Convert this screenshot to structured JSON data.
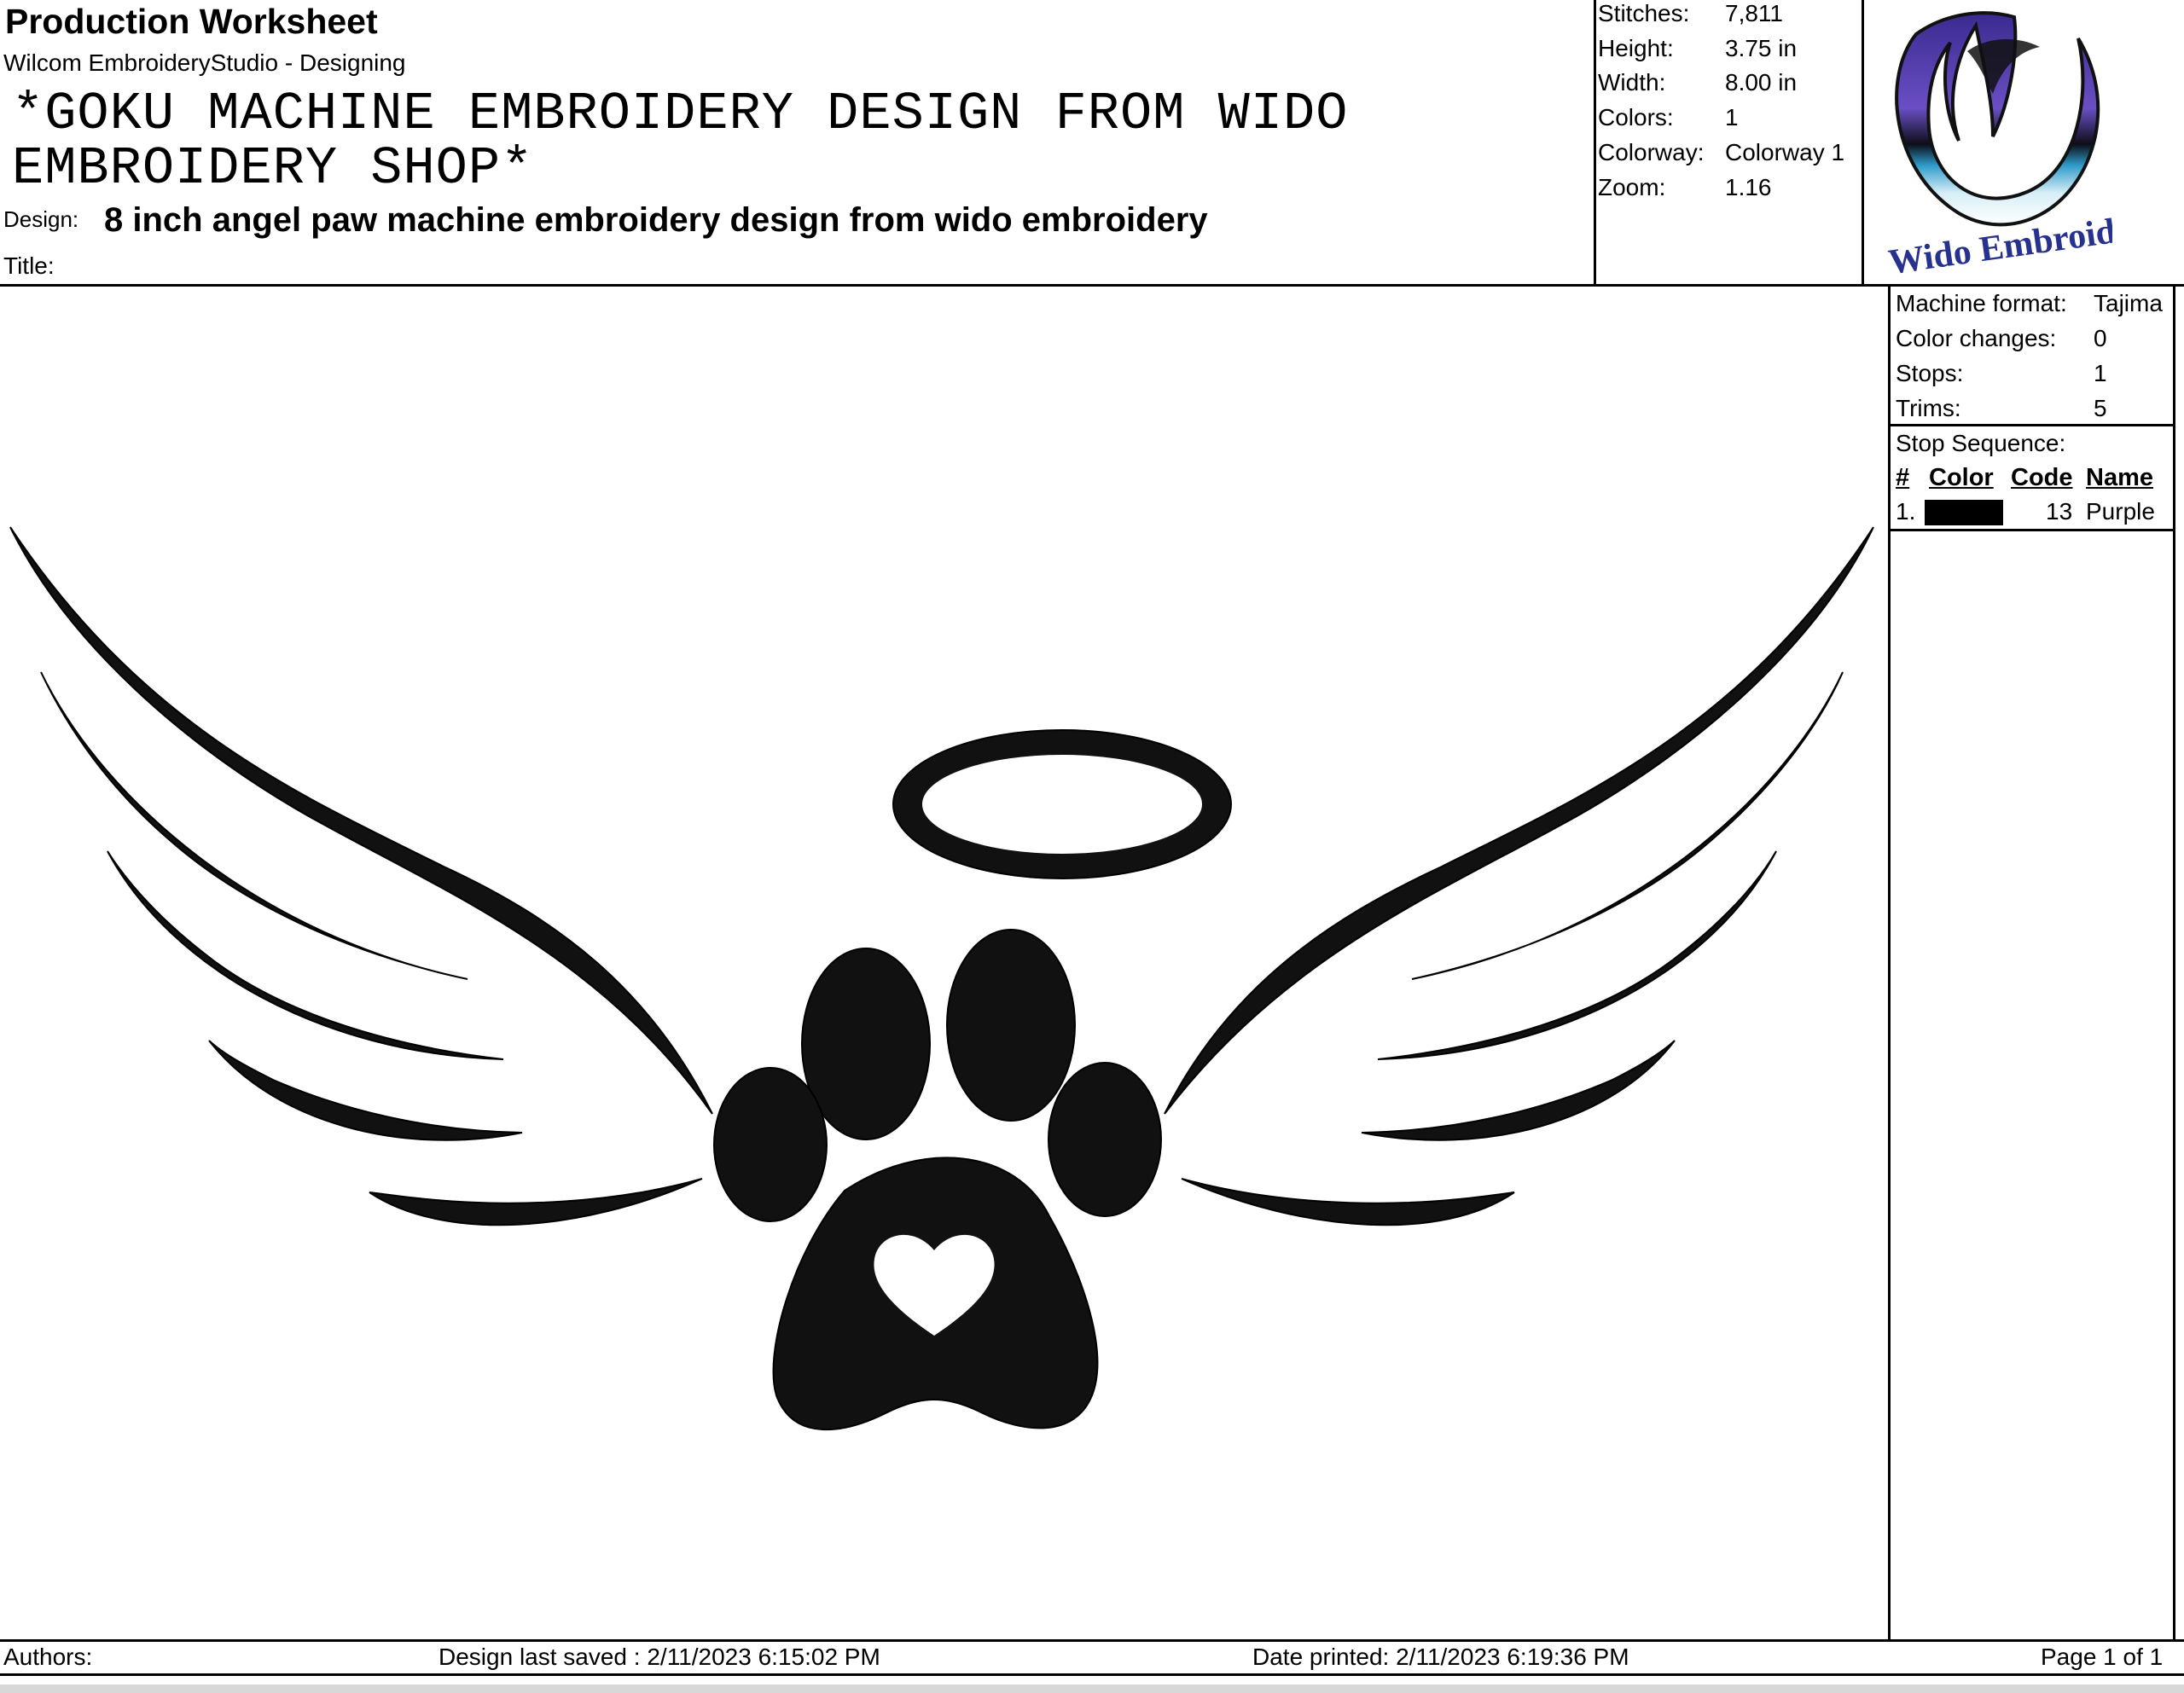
{
  "header": {
    "title": "Production Worksheet",
    "subtitle": "Wilcom EmbroideryStudio - Designing",
    "description": "*GOKU MACHINE EMBROIDERY DESIGN FROM WIDO EMBROIDERY SHOP*",
    "design_label": "Design:",
    "design_value": "8  inch angel paw machine embroidery design from wido embroidery",
    "title_label": "Title:",
    "title_value": ""
  },
  "stats": [
    {
      "label": "Stitches:",
      "value": "7,811"
    },
    {
      "label": "Height:",
      "value": "3.75 in"
    },
    {
      "label": "Width:",
      "value": "8.00 in"
    },
    {
      "label": "Colors:",
      "value": "1"
    },
    {
      "label": "Colorway:",
      "value": "Colorway 1"
    },
    {
      "label": "Zoom:",
      "value": "1.16"
    }
  ],
  "logo": {
    "text": "Wido Embroidery",
    "icon": "wido-logo-icon"
  },
  "machine": [
    {
      "label": "Machine format:",
      "value": "Tajima"
    },
    {
      "label": "Color changes:",
      "value": "0"
    },
    {
      "label": "Stops:",
      "value": "1"
    },
    {
      "label": "Trims:",
      "value": "5"
    }
  ],
  "stop_sequence": {
    "title": "Stop Sequence:",
    "columns": [
      "#",
      "Color",
      "Code",
      "Name"
    ],
    "rows": [
      {
        "num": "1.",
        "color": "#000000",
        "code": "13",
        "name": "Purple"
      }
    ]
  },
  "design_preview": {
    "icon": "angel-paw-wings-icon"
  },
  "footer": {
    "authors": "Authors:",
    "saved": "Design last saved : 2/11/2023 6:15:02 PM",
    "printed": "Date printed: 2/11/2023 6:19:36 PM",
    "page": "Page 1 of 1"
  }
}
